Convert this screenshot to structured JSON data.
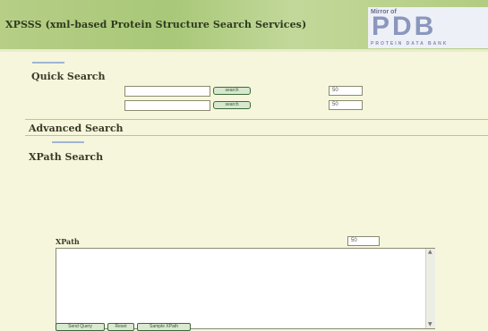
{
  "header": {
    "title": "XPSSS (xml-based Protein Structure Search Services)",
    "logo_small": "Mirror of",
    "logo_main": "PDB",
    "logo_sub": "PROTEIN DATA BANK"
  },
  "quick_search": {
    "heading": "Quick Search",
    "rows": [
      {
        "input_value": "",
        "button_label": "search",
        "count_value": "50"
      },
      {
        "input_value": "",
        "button_label": "search",
        "count_value": "50"
      }
    ]
  },
  "advanced_search": {
    "heading": "Advanced Search"
  },
  "xpath_search": {
    "heading": "XPath Search",
    "field_label": "XPath",
    "count_value": "50",
    "textarea_value": "",
    "buttons": [
      "Send Query",
      "Reset",
      "Sample XPath"
    ]
  },
  "colors": {
    "background": "#f6f6dc",
    "banner": "#a9c878",
    "separator": "#9fb4d4",
    "button_border": "#3a6a3a"
  }
}
